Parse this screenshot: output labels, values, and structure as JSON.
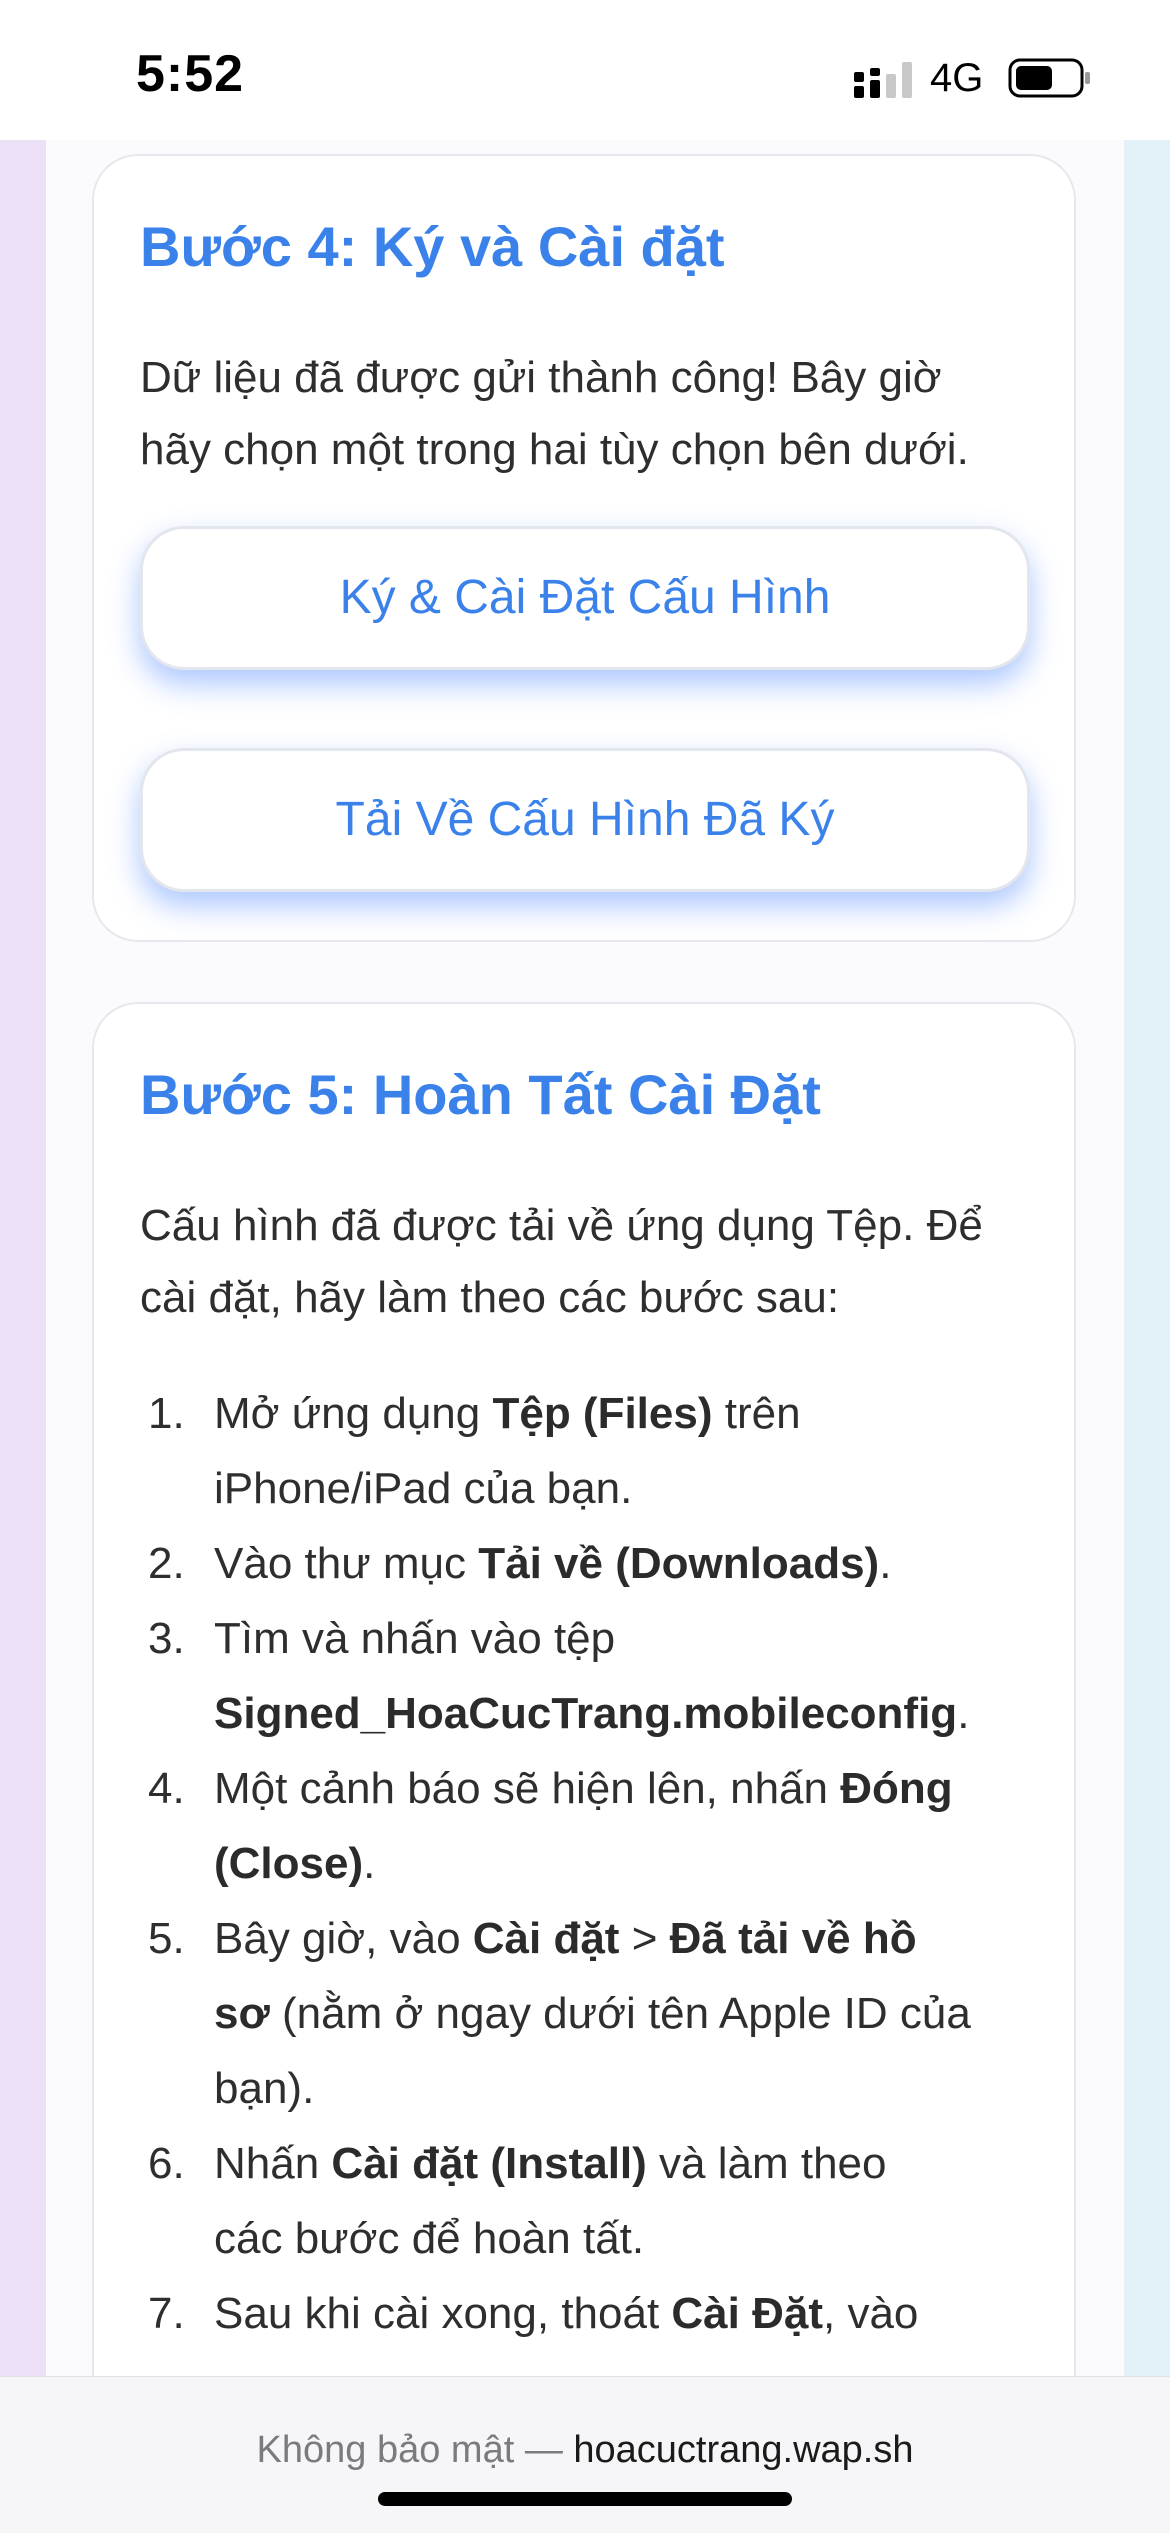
{
  "status_bar": {
    "time": "5:52",
    "network": "4G",
    "icons": [
      "signal-icon",
      "battery-icon"
    ]
  },
  "step4": {
    "title": "Bước 4: Ký và Cài đặt",
    "description_line1": "Dữ liệu đã được gửi thành công! Bây giờ",
    "description_line2": "hãy chọn một trong hai tùy chọn bên dưới.",
    "sign_install_button": "Ký & Cài Đặt Cấu Hình",
    "download_button": "Tải Về Cấu Hình Đã Ký"
  },
  "step5": {
    "title": "Bước 5: Hoàn Tất Cài Đặt",
    "description_line1": "Cấu hình đã được tải về ứng dụng Tệp. Để",
    "description_line2": "cài đặt, hãy làm theo các bước sau:",
    "steps": [
      {
        "num": "1.",
        "pre": "Mở ứng dụng ",
        "bold": "Tệp (Files)",
        "post": " trên",
        "line2": "iPhone/iPad của bạn."
      },
      {
        "num": "2.",
        "pre": "Vào thư mục ",
        "bold": "Tải về (Downloads)",
        "post": "."
      },
      {
        "num": "3.",
        "pre": "Tìm và nhấn vào tệp",
        "bold": "Signed_HoaCucTrang.mobileconfig",
        "post": "."
      },
      {
        "num": "4.",
        "pre": "Một cảnh báo sẽ hiện lên, nhấn ",
        "bold": "Đóng",
        "line2_bold": "(Close)",
        "post": "."
      },
      {
        "num": "5.",
        "pre": "Bây giờ, vào ",
        "bold": "Cài đặt",
        "mid": " > ",
        "bold2": "Đã tải về hồ",
        "line2_bold": "sơ",
        "line2": " (nằm ở ngay dưới tên Apple ID của",
        "line3": "bạn)."
      },
      {
        "num": "6.",
        "pre": "Nhấn ",
        "bold": "Cài đặt (Install)",
        "post": " và làm theo",
        "line2": "các bước để hoàn tất."
      },
      {
        "num": "7.",
        "pre": "Sau khi cài xong, thoát ",
        "bold": "Cài Đặt",
        "post": ", vào"
      }
    ]
  },
  "browser": {
    "insecure_label": "Không bảo mật — ",
    "domain": "hoacuctrang.wap.sh"
  }
}
